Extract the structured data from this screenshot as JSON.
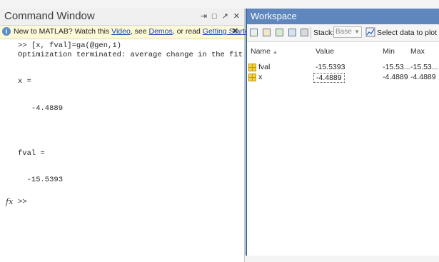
{
  "command_window": {
    "title": "Command Window",
    "info_bar": {
      "prefix": "New to MATLAB? Watch this ",
      "link_video": "Video",
      "sep1": ", see ",
      "link_demos": "Demos",
      "sep2": ", or read ",
      "link_getting_started": "Getting Started",
      "suffix": "."
    },
    "lines": {
      "l1": ">> [x, fval]=ga(@gen,1)",
      "l2": "Optimization terminated: average change in the fitness",
      "l3": "x =",
      "l4": "   -4.4889",
      "l5": "fval =",
      "l6": "  -15.5393",
      "prompt": ">>"
    },
    "fx_symbol": "fx"
  },
  "workspace": {
    "title": "Workspace",
    "toolbar": {
      "stack_label": "Stack:",
      "stack_value": "Base",
      "select_data_label": "Select data to plot"
    },
    "columns": {
      "name": "Name",
      "value": "Value",
      "min": "Min",
      "max": "Max"
    },
    "variables": [
      {
        "name": "fval",
        "value": "-15.5393",
        "min": "-15.53...",
        "max": "-15.53..."
      },
      {
        "name": "x",
        "value": "-4.4889",
        "min": "-4.4889",
        "max": "-4.4889"
      }
    ]
  }
}
